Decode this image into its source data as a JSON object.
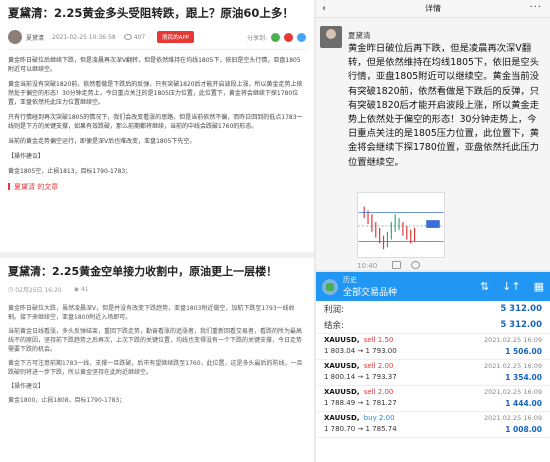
{
  "article1": {
    "title": "夏黛清：2.25黄金多头受阻转跌，跟上？原油60上多！",
    "author": "夏黛清",
    "date": "2021-02-25 10:36:58",
    "views": "407",
    "app_button": "股民的APP",
    "share_label": "分享到:",
    "paragraphs": [
      "黄金昨日破位后继续下跌，但是凌晨再次深V翻转，但是依然维持在均线1805下，依旧是空头行情，亚盘1805附近可以继续空。",
      "黄金当前没有突破1820前，依然看做是下跌后的反弹，只有突破1820后才能开启波段上涨，所以黄金走势上依然处于偏空的形态！30分钟走势上，今日重点关注的是1805压力位置，此位置下，黄金将会继续下探1780位置，亚盘依然托此压力位置继续空。",
      "只有行情碰到再次突破1805的情况下，我们会改变看涨的思路，但是当前依然不偏，而昨日回到的低点1783一线则是下方的关键支撑，如果有效跌破，那么前期都将继续，当前的中线会跌破1760的形态。",
      "当前的黄金走势偏空运行，即便是深V后也难改变，亚盘1805下先空。"
    ],
    "advice_title": "【操作建议】",
    "advice": "黄金1805空，止损1813，目标1790-1783；",
    "more_label": "夏黛清 的文章"
  },
  "article2": {
    "title": "夏黛清：2.25黄金空单接力收割中，原油更上一层楼！",
    "date": "02月25日 16:20",
    "views": "41",
    "paragraphs": [
      "黄金昨日破位大跌，虽然凌晨深V，但是并没有改变下跌趋势，亚盘1803附近做空，加航下跌至1793一线收割。接下来继续空，亚盘1800附近入场即可。",
      "当前黄金日线看涨，多头反弹结束，重回下跌走势，勤奋看涨的追涨者，我们重新回看交易者，看跌的所为最高线不的原因，坚持前下跌趋势之后再次，上次下跌的关键位置，均线也变得没有一个下跌的关键支撑，今日走势需要下跌的机会。",
      "黄金下方可注意前期1783一线，支撑一旦跌破，后市有望继续跌至1760，此位置，这是多头最后的防线，一旦跌破则将进一步下跌，所以黄金坚持在此附近继续空。"
    ],
    "advice_title": "【操作建议】",
    "advice": "黄金1800，止损1808，目标1790-1783；"
  },
  "chat": {
    "header_title": "详情",
    "back": "‹",
    "more": "···",
    "author": "夏黛清",
    "message": "黄金昨日破位后再下跌，但是凌晨再次深V翻转，但是依然维持在均线1805下，依旧是空头行情，亚盘1805附近可以继续空。黄金当前没有突破1820前，依然看做是下跌后的反弹，只有突破1820后才能开启波段上涨，所以黄金走势上依然处于偏空的形态！30分钟走势上，今日重点关注的是1805压力位置，此位置下，黄金将会继续下探1780位置，亚盘依然托此压力位置继续空。",
    "time": "10:40"
  },
  "mt": {
    "history": "历史",
    "all_symbols": "全部交易品种",
    "profit_label": "利润:",
    "profit_value": "5 312.00",
    "balance_label": "结余:",
    "balance_value": "5 312.00",
    "trades": [
      {
        "symbol": "XAUUSD,",
        "side": "sell 1.50",
        "type": "sell",
        "prices": "1 803.04 → 1 793.00",
        "date": "2021.02.25 16:09",
        "profit": "1 506.00"
      },
      {
        "symbol": "XAUUSD,",
        "side": "sell 2.00",
        "type": "sell",
        "prices": "1 800.14 → 1 793.37",
        "date": "2021.02.25 16:09",
        "profit": "1 354.00"
      },
      {
        "symbol": "XAUUSD,",
        "side": "sell 2.00",
        "type": "sell",
        "prices": "1 788.49 → 1 781.27",
        "date": "2021.02.25 16:09",
        "profit": "1 444.00"
      },
      {
        "symbol": "XAUUSD,",
        "side": "buy 2.00",
        "type": "buy",
        "prices": "1 780.70 → 1 785.74",
        "date": "2021.02.25 16:09",
        "profit": "1 008.00"
      }
    ]
  }
}
